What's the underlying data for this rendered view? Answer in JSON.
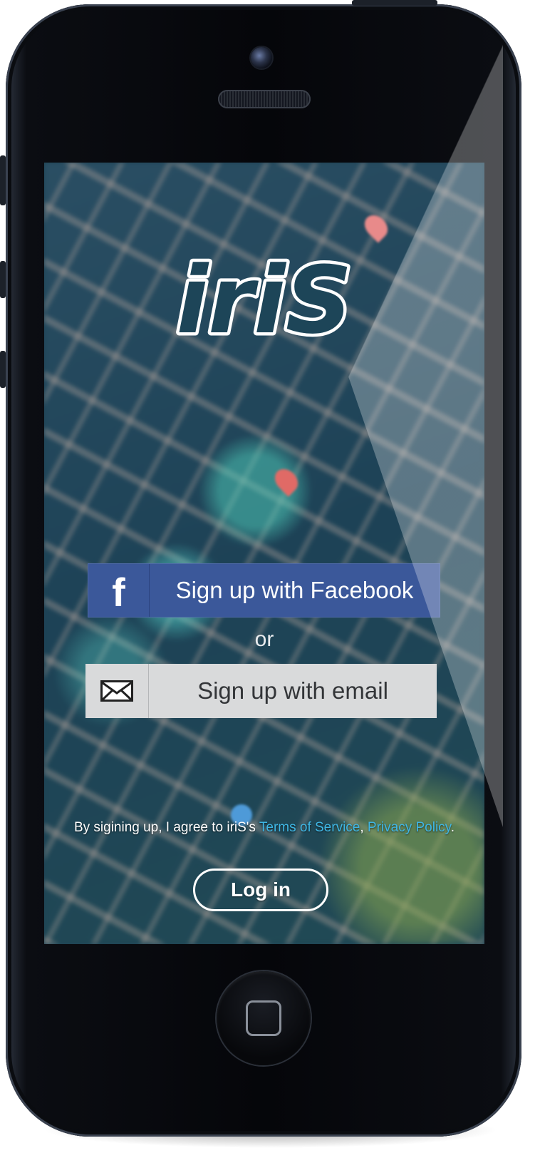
{
  "app": {
    "logo_text": "iriS",
    "facebook_button": {
      "icon": "facebook-f-icon",
      "label": "Sign up with Facebook",
      "color": "#3b589a"
    },
    "separator": "or",
    "email_button": {
      "icon": "envelope-icon",
      "label": "Sign up with email",
      "color": "#d9dadb"
    },
    "terms": {
      "prefix": "By sigining up, I agree to iriS's ",
      "tos_link": "Terms of Service",
      "separator": ", ",
      "privacy_link": "Privacy Policy",
      "suffix": ".",
      "link_color": "#3fb6e4"
    },
    "login_button": {
      "label": "Log in"
    }
  }
}
